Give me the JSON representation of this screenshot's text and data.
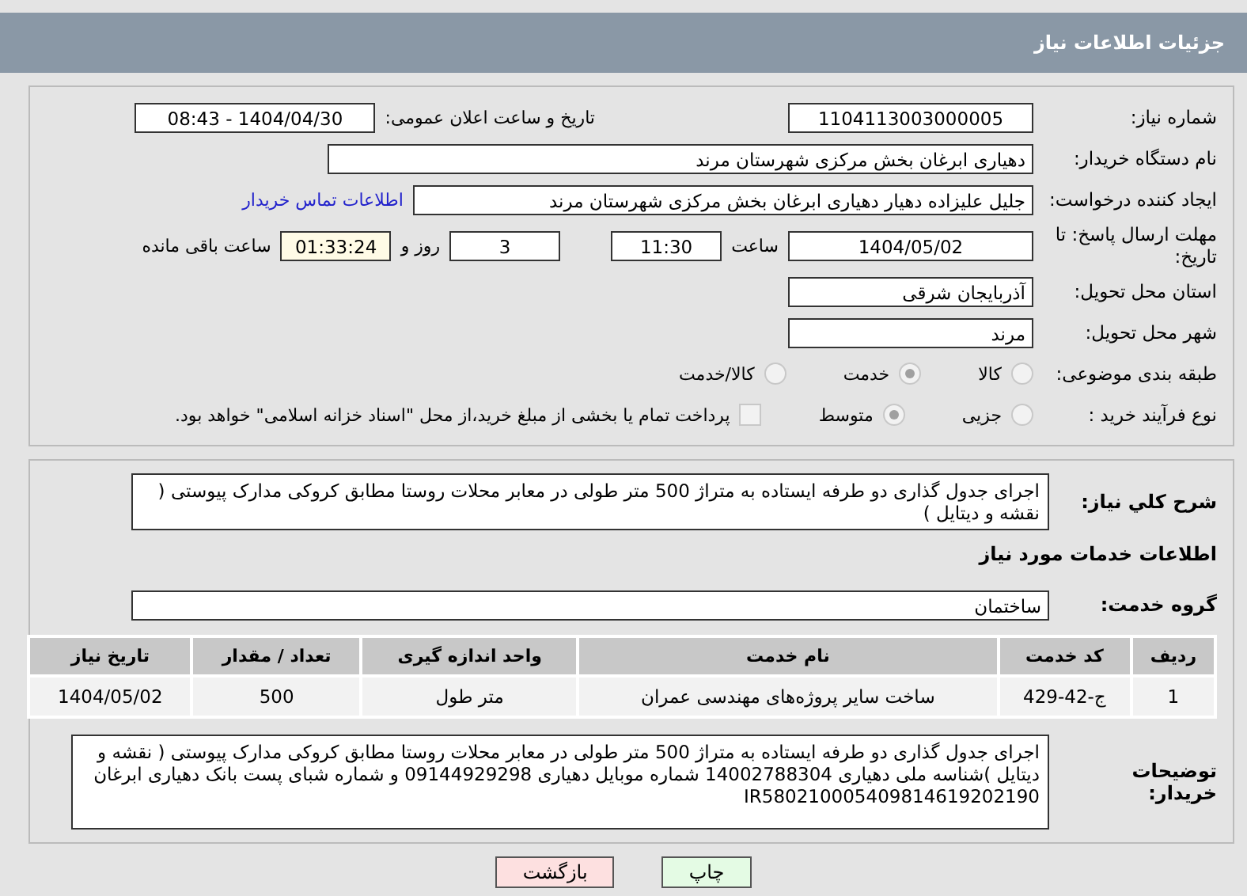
{
  "header": {
    "title": "جزئیات اطلاعات نیاز"
  },
  "fields": {
    "need_number": {
      "label": "شماره نیاز:",
      "value": "1104113003000005"
    },
    "announce": {
      "label": "تاریخ و ساعت اعلان عمومی:",
      "value": "1404/04/30 - 08:43"
    },
    "buyer": {
      "label": "نام دستگاه خریدار:",
      "value": "دهیاری ابرغان بخش مرکزی شهرستان مرند"
    },
    "creator": {
      "label": "ایجاد کننده درخواست:",
      "value": "جلیل علیزاده دهیار دهیاری ابرغان بخش مرکزی شهرستان مرند",
      "link": "اطلاعات تماس خریدار"
    },
    "deadline": {
      "label": "مهلت ارسال پاسخ: تا تاریخ:",
      "date": "1404/05/02",
      "time_label": "ساعت",
      "time": "11:30",
      "days": "3",
      "days_label": "روز و",
      "remaining": "01:33:24",
      "remaining_label": "ساعت باقی مانده"
    },
    "province": {
      "label": "استان محل تحویل:",
      "value": "آذربایجان شرقی"
    },
    "city": {
      "label": "شهر محل تحویل:",
      "value": "مرند"
    }
  },
  "category": {
    "label": "طبقه بندی موضوعی:",
    "options": [
      {
        "label": "کالا",
        "selected": false
      },
      {
        "label": "خدمت",
        "selected": true
      },
      {
        "label": "کالا/خدمت",
        "selected": false
      }
    ]
  },
  "process": {
    "label": "نوع فرآیند خرید :",
    "options": [
      {
        "label": "جزیی",
        "selected": false
      },
      {
        "label": "متوسط",
        "selected": true
      }
    ],
    "payment": {
      "label": "پرداخت تمام یا بخشی از مبلغ خرید،از محل \"اسناد خزانه اسلامی\" خواهد بود.",
      "checked": false
    }
  },
  "summary": {
    "label": "شرح کلي نياز:",
    "value": "اجرای جدول گذاری دو طرفه ایستاده به متراژ 500 متر طولی در معابر محلات روستا مطابق کروکی مدارک پیوستی  ( نقشه  و دیتایل )"
  },
  "services_heading": "اطلاعات خدمات مورد نیاز",
  "service_group": {
    "label": "گروه خدمت:",
    "value": "ساختمان"
  },
  "table": {
    "columns": [
      "ردیف",
      "کد خدمت",
      "نام خدمت",
      "واحد اندازه گیری",
      "تعداد / مقدار",
      "تاریخ نیاز"
    ],
    "rows": [
      [
        "1",
        "ج-42-429",
        "ساخت سایر پروژه‌های مهندسی عمران",
        "متر طول",
        "500",
        "1404/05/02"
      ]
    ]
  },
  "buyer_notes": {
    "label": "توضیحات خریدار:",
    "value": "اجرای جدول گذاری دو طرفه ایستاده به متراژ 500 متر طولی در معابر محلات روستا مطابق کروکی مدارک پیوستی  ( نقشه  و دیتایل )شناسه ملی دهیاری 14002788304 شماره موبایل دهیاری 09144929298 و شماره شبای پست بانک دهیاری ابرغان IR580210005409814619202190"
  },
  "buttons": [
    {
      "label": "چاپ",
      "kind": "print"
    },
    {
      "label": "بازگشت",
      "kind": "back"
    }
  ]
}
